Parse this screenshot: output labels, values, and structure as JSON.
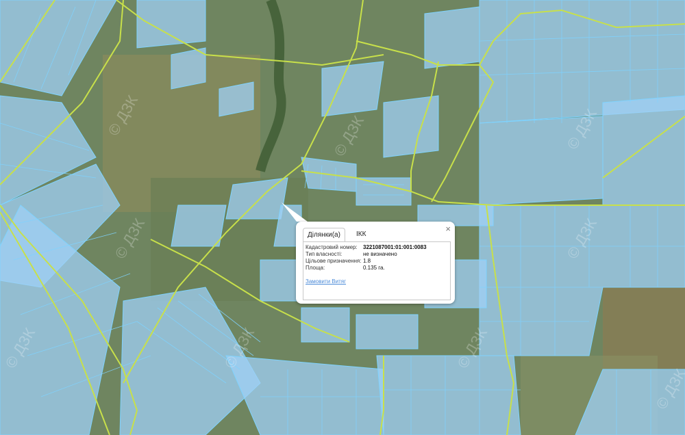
{
  "map": {
    "watermark": "© ДЗК",
    "parcel_fill": "#9fd0f5",
    "parcel_stroke": "#7fd3ff",
    "road_color": "#c8e04a"
  },
  "popup": {
    "tabs": [
      {
        "label": "Ділянки(а)",
        "active": true
      },
      {
        "label": "ІКК",
        "active": false
      }
    ],
    "close_symbol": "×",
    "fields": [
      {
        "label": "Кадастровий номер:",
        "value": "3221087001:01:001:0083"
      },
      {
        "label": "Тип власності:",
        "value": "не визначено"
      },
      {
        "label": "Цільове призначення:",
        "value": "1.8"
      },
      {
        "label": "Площа:",
        "value": "0.135 га."
      }
    ],
    "order_link": "Замовити Витяг"
  }
}
